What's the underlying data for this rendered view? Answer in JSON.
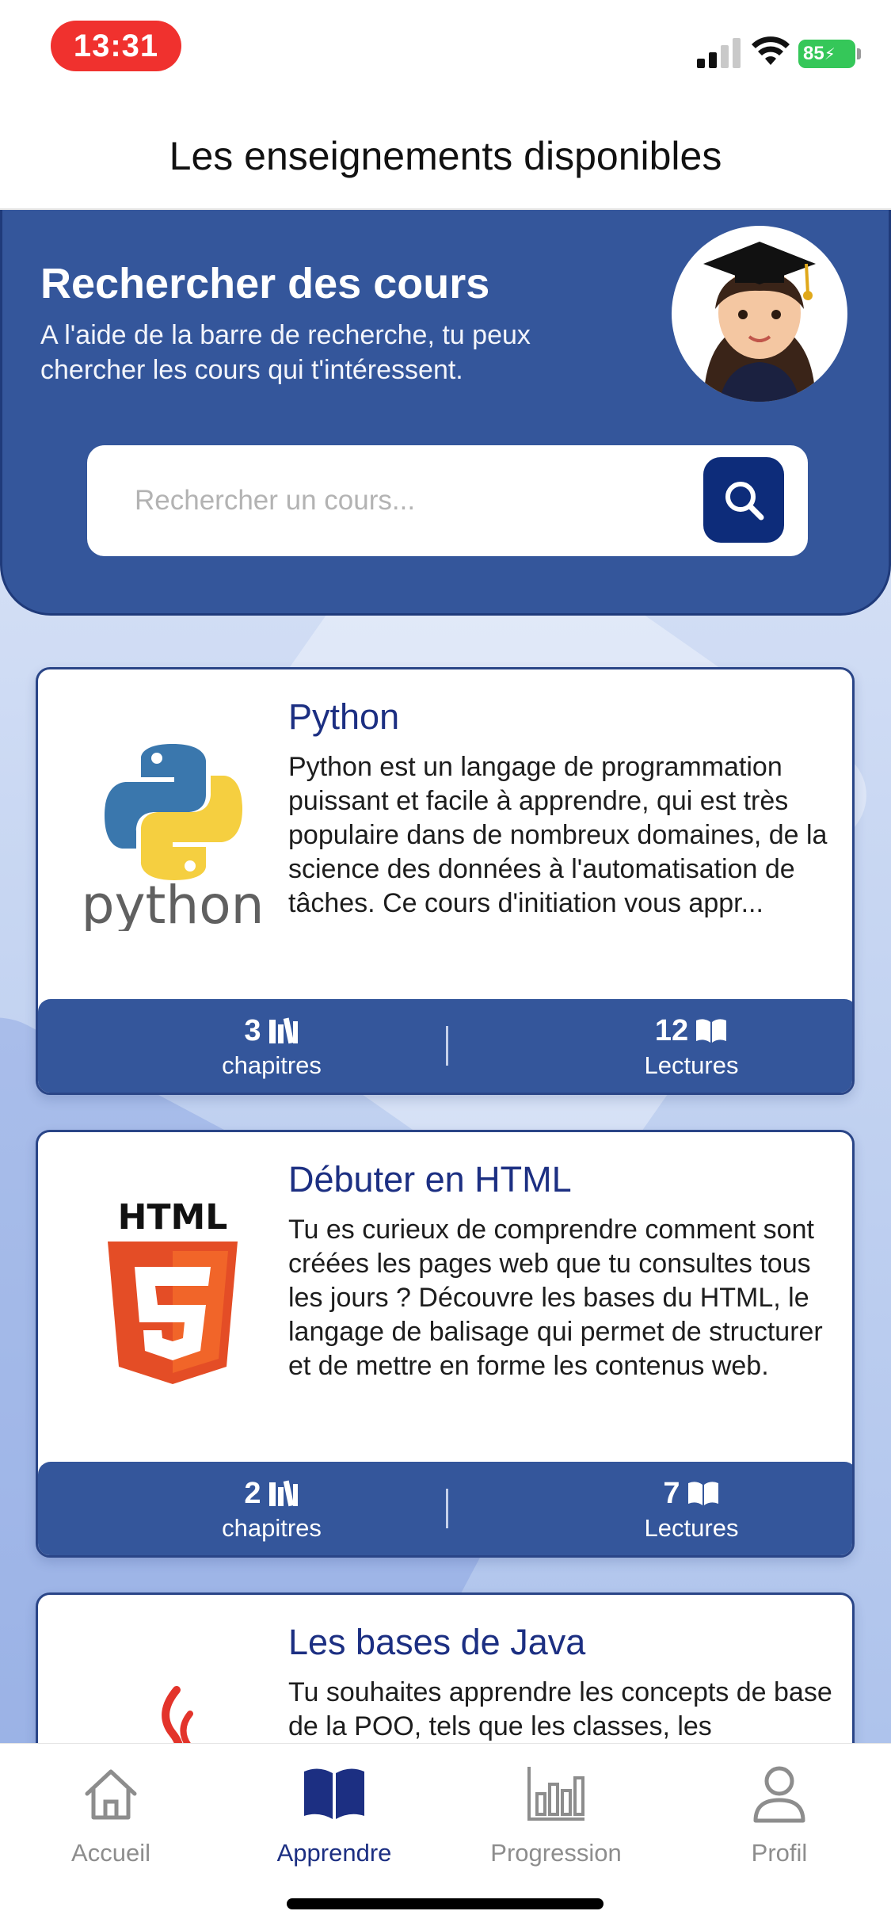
{
  "status_bar": {
    "time": "13:31",
    "battery": "85"
  },
  "header": {
    "title": "Les enseignements disponibles"
  },
  "hero": {
    "title": "Rechercher des cours",
    "text": "A l'aide de la barre de recherche, tu peux chercher les cours qui t'intéressent.",
    "search_placeholder": "Rechercher un cours..."
  },
  "courses": [
    {
      "title": "Python",
      "description": "Python est un langage de programmation puissant et facile à apprendre, qui est très populaire dans de nombreux domaines, de la science des données à l'automatisation de tâches. Ce cours d'initiation vous appr...",
      "logo_text": "python",
      "chapters_count": "3",
      "chapters_label": "chapitres",
      "readings_count": "12",
      "readings_label": "Lectures"
    },
    {
      "title": "Débuter en HTML",
      "description": "Tu es curieux de comprendre comment sont créées les pages web que tu consultes tous les jours ? Découvre les bases du HTML, le langage de balisage qui permet de structurer et de mettre en forme les contenus web.",
      "logo_text": "HTML",
      "logo_number": "5",
      "chapters_count": "2",
      "chapters_label": "chapitres",
      "readings_count": "7",
      "readings_label": "Lectures"
    },
    {
      "title": "Les bases de Java",
      "description": "Tu souhaites apprendre les concepts de base de la POO, tels que les classes, les"
    }
  ],
  "nav": [
    {
      "label": "Accueil",
      "icon": "home-icon"
    },
    {
      "label": "Apprendre",
      "icon": "book-icon"
    },
    {
      "label": "Progression",
      "icon": "chart-icon"
    },
    {
      "label": "Profil",
      "icon": "profile-icon"
    }
  ],
  "colors": {
    "primary": "#34569b",
    "dark": "#0d2c7a",
    "title": "#1c2f82"
  }
}
